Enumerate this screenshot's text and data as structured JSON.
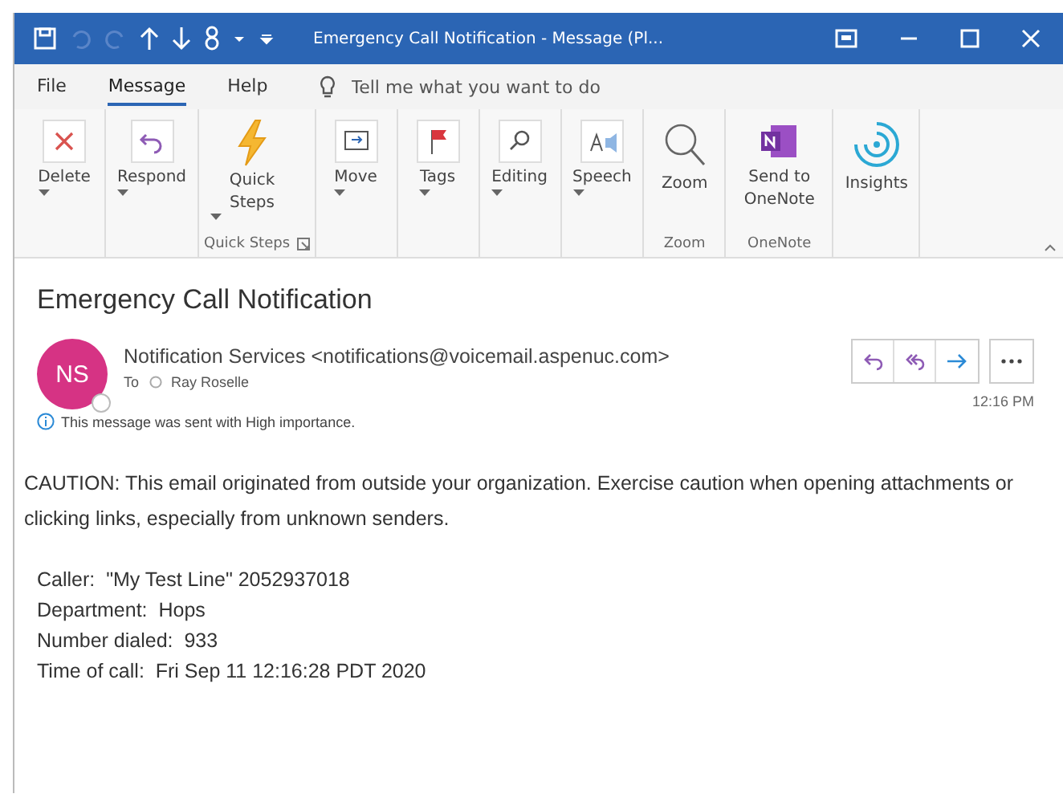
{
  "window": {
    "title": "Emergency Call Notification  -  Message (Pl..."
  },
  "menu_tabs": [
    {
      "label": "File",
      "selected": false
    },
    {
      "label": "Message",
      "selected": true
    },
    {
      "label": "Help",
      "selected": false
    }
  ],
  "tell_me": {
    "placeholder": "Tell me what you want to do"
  },
  "ribbon": {
    "sections": [
      {
        "buttons": [
          {
            "kind": "delete",
            "label": "Delete",
            "dropdown": true
          }
        ]
      },
      {
        "buttons": [
          {
            "kind": "respond",
            "label": "Respond",
            "dropdown": true
          }
        ]
      },
      {
        "label": "Quick Steps",
        "launcher": true,
        "buttons": [
          {
            "kind": "quicksteps",
            "label": "Quick Steps",
            "dropdown": true
          }
        ]
      },
      {
        "buttons": [
          {
            "kind": "move",
            "label": "Move",
            "dropdown": true
          }
        ]
      },
      {
        "buttons": [
          {
            "kind": "tags",
            "label": "Tags",
            "dropdown": true
          }
        ]
      },
      {
        "buttons": [
          {
            "kind": "editing",
            "label": "Editing",
            "dropdown": true
          }
        ]
      },
      {
        "buttons": [
          {
            "kind": "speech",
            "label": "Speech",
            "dropdown": true
          }
        ]
      },
      {
        "label": "Zoom",
        "launcher": false,
        "buttons": [
          {
            "kind": "zoom",
            "label": "Zoom",
            "dropdown": false
          }
        ]
      },
      {
        "label": "OneNote",
        "launcher": false,
        "buttons": [
          {
            "kind": "onenote",
            "label": "Send to OneNote",
            "dropdown": false
          }
        ]
      },
      {
        "buttons": [
          {
            "kind": "insights",
            "label": "Insights",
            "dropdown": false
          }
        ]
      }
    ]
  },
  "message": {
    "subject": "Emergency Call Notification",
    "avatar": "NS",
    "sender": "Notification Services <notifications@voicemail.aspenuc.com>",
    "to_label": "To",
    "recipient": "Ray Roselle",
    "time": "12:16 PM",
    "importance": "This message was sent with High importance.",
    "caution": "CAUTION: This email originated from outside your organization. Exercise caution when opening attachments or clicking links, especially from unknown senders.",
    "details": [
      "Caller:  \"My Test Line\" 2052937018",
      "Department:  Hops",
      "Number dialed:  933",
      "Time of call:  Fri Sep 11 12:16:28 PDT 2020"
    ]
  }
}
